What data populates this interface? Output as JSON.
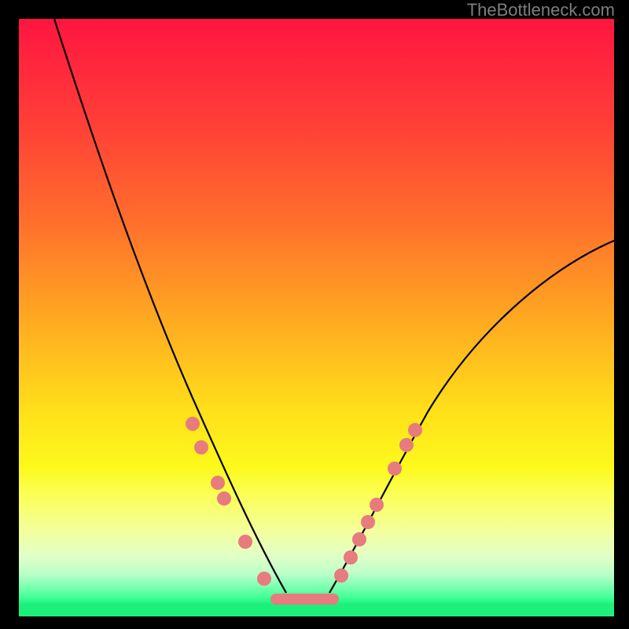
{
  "watermark": "TheBottleneck.com",
  "chart_data": {
    "type": "line",
    "title": "",
    "xlabel": "",
    "ylabel": "",
    "xlim": [
      0,
      100
    ],
    "ylim": [
      0,
      100
    ],
    "series": [
      {
        "name": "left-curve",
        "x": [
          6,
          10,
          14,
          18,
          22,
          26,
          30,
          34,
          37,
          40,
          42,
          44,
          46
        ],
        "y": [
          100,
          90,
          78,
          66,
          55,
          45,
          35,
          26,
          18,
          12,
          8,
          5,
          4
        ]
      },
      {
        "name": "right-curve",
        "x": [
          52,
          55,
          58,
          62,
          66,
          70,
          75,
          82,
          90,
          100
        ],
        "y": [
          4,
          6,
          10,
          16,
          23,
          30,
          38,
          47,
          55,
          63
        ]
      },
      {
        "name": "bottom-segment",
        "x": [
          43,
          53
        ],
        "y": [
          3,
          3
        ]
      }
    ],
    "points_left": [
      {
        "x": 29,
        "y": 32
      },
      {
        "x": 30.5,
        "y": 28
      },
      {
        "x": 33.5,
        "y": 22
      },
      {
        "x": 34.5,
        "y": 19.5
      },
      {
        "x": 38,
        "y": 12
      },
      {
        "x": 41,
        "y": 6
      }
    ],
    "points_right": [
      {
        "x": 54,
        "y": 7
      },
      {
        "x": 55.5,
        "y": 10
      },
      {
        "x": 57,
        "y": 13
      },
      {
        "x": 58.5,
        "y": 16
      },
      {
        "x": 60,
        "y": 19
      },
      {
        "x": 63,
        "y": 25
      },
      {
        "x": 65,
        "y": 29
      },
      {
        "x": 66.5,
        "y": 31.5
      }
    ],
    "gradient_stops": [
      {
        "pos": 0,
        "color": "#ff153f"
      },
      {
        "pos": 50,
        "color": "#ffa821"
      },
      {
        "pos": 75,
        "color": "#fdf91c"
      },
      {
        "pos": 97,
        "color": "#3bff93"
      },
      {
        "pos": 100,
        "color": "#1cf07a"
      }
    ]
  }
}
